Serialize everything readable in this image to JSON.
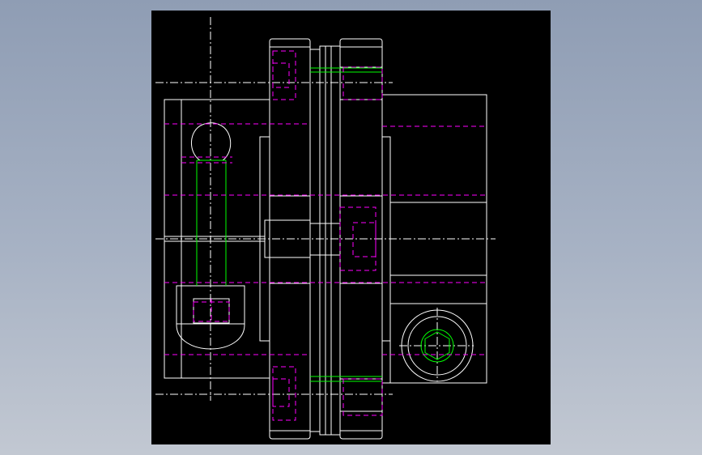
{
  "colors": {
    "background_outer": "#98a4b8",
    "viewport": "#000000",
    "outline": "#ffffff",
    "hidden_line": "#ff00ff",
    "thread": "#00ff00",
    "centerline": "#ffffff"
  },
  "drawing": {
    "subject": "coupling-assembly",
    "line_styles": [
      "solid",
      "dashed",
      "dash-dot"
    ]
  }
}
